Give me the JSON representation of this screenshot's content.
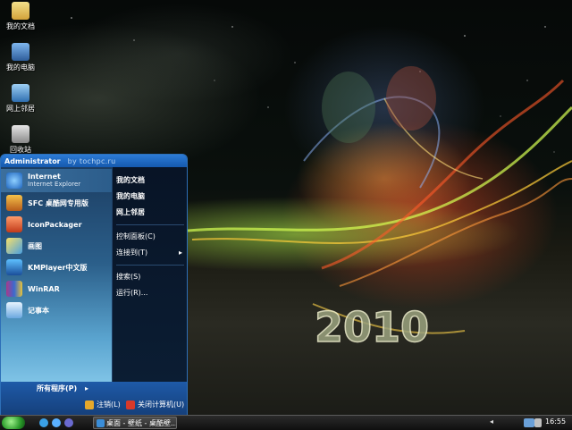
{
  "desktop": {
    "icons": [
      {
        "label": "我的文档",
        "icon": "my-documents-icon"
      },
      {
        "label": "我的电脑",
        "icon": "my-computer-icon"
      },
      {
        "label": "网上邻居",
        "icon": "network-places-icon"
      },
      {
        "label": "回收站",
        "icon": "recycle-bin-icon"
      }
    ]
  },
  "start_menu": {
    "user": "Administrator",
    "byline": "by tochpc.ru",
    "left_items": [
      {
        "title": "Internet",
        "subtitle": "Internet Explorer",
        "icon": "internet-explorer-icon"
      },
      {
        "title": "SFC 桌酷网专用版",
        "icon": "sfc-icon"
      },
      {
        "title": "IconPackager",
        "icon": "iconpackager-icon"
      },
      {
        "title": "画图",
        "icon": "paint-icon"
      },
      {
        "title": "KMPlayer中文版",
        "icon": "kmplayer-icon"
      },
      {
        "title": "WinRAR",
        "icon": "winrar-icon"
      },
      {
        "title": "记事本",
        "icon": "notepad-icon"
      }
    ],
    "all_programs": "所有程序(P)",
    "right_items": [
      {
        "label": "我的文档",
        "bold": true
      },
      {
        "label": "我的电脑",
        "bold": true
      },
      {
        "label": "网上邻居",
        "bold": true
      },
      {
        "label": "控制面板(C)",
        "bold": false
      },
      {
        "label": "连接到(T)",
        "bold": false
      },
      {
        "label": "搜索(S)",
        "bold": false
      },
      {
        "label": "运行(R)...",
        "bold": false
      }
    ],
    "logoff": "注销(L)",
    "shutdown": "关闭计算机(U)"
  },
  "taskbar": {
    "task_title": "桌面 - 壁纸 - 桌酷壁...",
    "clock": "16:55"
  },
  "wallpaper": {
    "text": "2010"
  },
  "colors": {
    "start_menu_header": "#1559ae",
    "taskbar": "#1a1a1a",
    "accent_green": "#2a9a2a"
  }
}
